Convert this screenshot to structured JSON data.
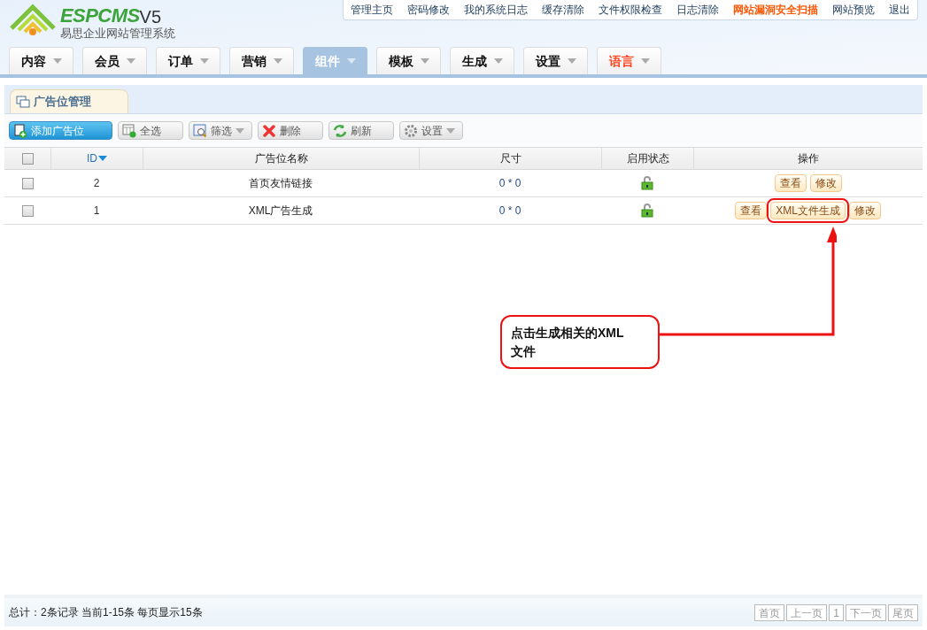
{
  "logo": {
    "brand": "ESPCMS",
    "version": "V5",
    "subtitle": "易思企业网站管理系统"
  },
  "top_links": [
    {
      "label": "管理主页",
      "emphasis": false
    },
    {
      "label": "密码修改",
      "emphasis": false
    },
    {
      "label": "我的系统日志",
      "emphasis": false
    },
    {
      "label": "缓存清除",
      "emphasis": false
    },
    {
      "label": "文件权限检查",
      "emphasis": false
    },
    {
      "label": "日志清除",
      "emphasis": false
    },
    {
      "label": "网站漏洞安全扫描",
      "emphasis": true
    },
    {
      "label": "网站预览",
      "emphasis": false
    },
    {
      "label": "退出",
      "emphasis": false
    }
  ],
  "nav_tabs": [
    {
      "label": "内容",
      "selected": false,
      "emphasis": false
    },
    {
      "label": "会员",
      "selected": false,
      "emphasis": false
    },
    {
      "label": "订单",
      "selected": false,
      "emphasis": false
    },
    {
      "label": "营销",
      "selected": false,
      "emphasis": false
    },
    {
      "label": "组件",
      "selected": true,
      "emphasis": false
    },
    {
      "label": "模板",
      "selected": false,
      "emphasis": false
    },
    {
      "label": "生成",
      "selected": false,
      "emphasis": false
    },
    {
      "label": "设置",
      "selected": false,
      "emphasis": false
    },
    {
      "label": "语言",
      "selected": false,
      "emphasis": true
    }
  ],
  "panel_tab": "广告位管理",
  "toolbar": [
    {
      "label": "添加广告位",
      "kind": "add",
      "primary": true,
      "dropdown": false
    },
    {
      "label": "全选",
      "kind": "select",
      "primary": false,
      "dropdown": false
    },
    {
      "label": "筛选",
      "kind": "filter",
      "primary": false,
      "dropdown": true
    },
    {
      "label": "删除",
      "kind": "delete",
      "primary": false,
      "dropdown": false
    },
    {
      "label": "刷新",
      "kind": "refresh",
      "primary": false,
      "dropdown": false
    },
    {
      "label": "设置",
      "kind": "settings",
      "primary": false,
      "dropdown": true
    }
  ],
  "table": {
    "columns": [
      "ID",
      "广告位名称",
      "尺寸",
      "启用状态",
      "操作"
    ],
    "header_checked": false,
    "rows": [
      {
        "checked": false,
        "id": "2",
        "name": "首页友情链接",
        "size": "0 * 0",
        "enabled": true,
        "actions": [
          {
            "label": "查看",
            "highlighted": false
          },
          {
            "label": "修改",
            "highlighted": false
          }
        ]
      },
      {
        "checked": false,
        "id": "1",
        "name": "XML广告生成",
        "size": "0 * 0",
        "enabled": true,
        "actions": [
          {
            "label": "查看",
            "highlighted": false
          },
          {
            "label": "XML文件生成",
            "highlighted": true
          },
          {
            "label": "修改",
            "highlighted": false
          }
        ]
      }
    ]
  },
  "callout": "点击生成相关的XML文件",
  "footer": {
    "summary": "总计：2条记录 当前1-15条 每页显示15条",
    "pager": [
      "首页",
      "上一页",
      "1",
      "下一页",
      "尾页"
    ]
  }
}
